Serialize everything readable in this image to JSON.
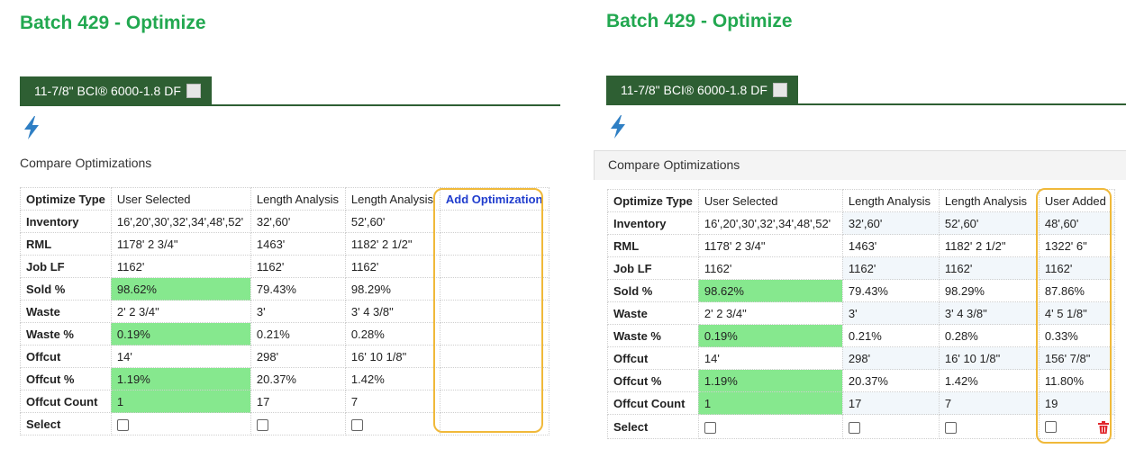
{
  "left": {
    "title": "Batch 429 - Optimize",
    "tab_label": "11-7/8\" BCI® 6000-1.8 DF",
    "section_label": "Compare Optimizations",
    "header": {
      "optimize_type": "Optimize Type",
      "col1": "User Selected",
      "col2": "Length Analysis",
      "col3": "Length Analysis",
      "add_link": "Add Optimization"
    },
    "rows": [
      {
        "label": "Inventory",
        "c1": "16',20',30',32',34',48',52'",
        "c2": "32',60'",
        "c3": "52',60'"
      },
      {
        "label": "RML",
        "c1": "1178' 2 3/4\"",
        "c2": "1463'",
        "c3": "1182' 2 1/2\""
      },
      {
        "label": "Job LF",
        "c1": "1162'",
        "c2": "1162'",
        "c3": "1162'"
      },
      {
        "label": "Sold %",
        "c1": "98.62%",
        "c2": "79.43%",
        "c3": "98.29%"
      },
      {
        "label": "Waste",
        "c1": "2' 2 3/4\"",
        "c2": "3'",
        "c3": "3' 4 3/8\""
      },
      {
        "label": "Waste %",
        "c1": "0.19%",
        "c2": "0.21%",
        "c3": "0.28%"
      },
      {
        "label": "Offcut",
        "c1": "14'",
        "c2": "298'",
        "c3": "16' 10 1/8\""
      },
      {
        "label": "Offcut %",
        "c1": "1.19%",
        "c2": "20.37%",
        "c3": "1.42%"
      },
      {
        "label": "Offcut Count",
        "c1": "1",
        "c2": "17",
        "c3": "7"
      }
    ],
    "select_label": "Select"
  },
  "right": {
    "title": "Batch 429 - Optimize",
    "tab_label": "11-7/8\" BCI® 6000-1.8 DF",
    "section_label": "Compare Optimizations",
    "header": {
      "optimize_type": "Optimize Type",
      "col1": "User Selected",
      "col2": "Length Analysis",
      "col3": "Length Analysis",
      "col4": "User Added"
    },
    "rows": [
      {
        "label": "Inventory",
        "c1": "16',20',30',32',34',48',52'",
        "c2": "32',60'",
        "c3": "52',60'",
        "c4": "48',60'"
      },
      {
        "label": "RML",
        "c1": "1178' 2 3/4\"",
        "c2": "1463'",
        "c3": "1182' 2 1/2\"",
        "c4": "1322' 6\""
      },
      {
        "label": "Job LF",
        "c1": "1162'",
        "c2": "1162'",
        "c3": "1162'",
        "c4": "1162'"
      },
      {
        "label": "Sold %",
        "c1": "98.62%",
        "c2": "79.43%",
        "c3": "98.29%",
        "c4": "87.86%"
      },
      {
        "label": "Waste",
        "c1": "2' 2 3/4\"",
        "c2": "3'",
        "c3": "3' 4 3/8\"",
        "c4": "4' 5 1/8\""
      },
      {
        "label": "Waste %",
        "c1": "0.19%",
        "c2": "0.21%",
        "c3": "0.28%",
        "c4": "0.33%"
      },
      {
        "label": "Offcut",
        "c1": "14'",
        "c2": "298'",
        "c3": "16' 10 1/8\"",
        "c4": "156' 7/8\""
      },
      {
        "label": "Offcut %",
        "c1": "1.19%",
        "c2": "20.37%",
        "c3": "1.42%",
        "c4": "11.80%"
      },
      {
        "label": "Offcut Count",
        "c1": "1",
        "c2": "17",
        "c3": "7",
        "c4": "19"
      }
    ],
    "select_label": "Select"
  },
  "icons": {
    "optimize": "lightning-bolt-icon",
    "delete": "trash-icon"
  },
  "colors": {
    "title_green": "#22a850",
    "tab_green": "#2e5f33",
    "highlight_cell": "#86e88e",
    "outline_box": "#f0b93a",
    "add_link": "#1f3ccd",
    "trash_red": "#e0262b"
  }
}
